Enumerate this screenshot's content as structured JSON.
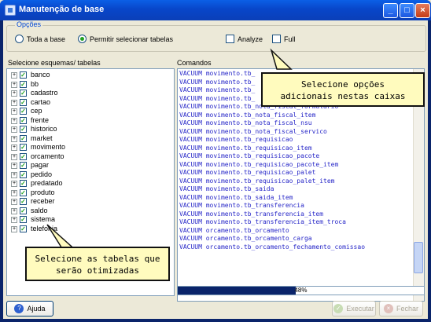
{
  "window": {
    "title": "Manutenção de base"
  },
  "options": {
    "legend": "Opções",
    "radio_all": "Toda a base",
    "radio_select": "Permitir selecionar tabelas",
    "check_analyze": "Analyze",
    "check_full": "Full",
    "selected_radio": "radio_select"
  },
  "tree": {
    "label": "Selecione esquemas/ tabelas",
    "items": [
      "banco",
      "bb",
      "cadastro",
      "cartao",
      "cep",
      "frente",
      "historico",
      "market",
      "movimento",
      "orcamento",
      "pagar",
      "pedido",
      "predatado",
      "produto",
      "receber",
      "saldo",
      "sistema",
      "telefonia"
    ]
  },
  "commands": {
    "label": "Comandos",
    "lines": [
      "VACUUM movimento.tb_",
      "VACUUM movimento.tb_",
      "VACUUM movimento.tb_",
      "VACUUM movimento.tb_",
      "VACUUM movimento.tb_nota_fiscal_formulario",
      "VACUUM movimento.tb_nota_fiscal_item",
      "VACUUM movimento.tb_nota_fiscal_nsu",
      "VACUUM movimento.tb_nota_fiscal_servico",
      "VACUUM movimento.tb_requisicao",
      "VACUUM movimento.tb_requisicao_item",
      "VACUUM movimento.tb_requisicao_pacote",
      "VACUUM movimento.tb_requisicao_pacote_item",
      "VACUUM movimento.tb_requisicao_palet",
      "VACUUM movimento.tb_requisicao_palet_item",
      "VACUUM movimento.tb_saida",
      "VACUUM movimento.tb_saida_item",
      "VACUUM movimento.tb_transferencia",
      "VACUUM movimento.tb_transferencia_item",
      "VACUUM movimento.tb_transferencia_item_troca",
      "VACUUM orcamento.tb_orcamento",
      "VACUUM orcamento.tb_orcamento_carga",
      "VACUUM orcamento.tb_orcamento_fechamento_comissao"
    ]
  },
  "progress": {
    "value": 48,
    "text": "48%"
  },
  "buttons": {
    "help": "Ajuda",
    "execute": "Executar",
    "close": "Fechar"
  },
  "callouts": {
    "options": "Selecione opções\nadicionais nestas caixas",
    "tables": "Selecione as tabelas que\nserão otimizadas"
  },
  "colors": {
    "accent": "#0a246a",
    "command_text": "#2727c8",
    "callout_bg": "#fffbbe"
  }
}
